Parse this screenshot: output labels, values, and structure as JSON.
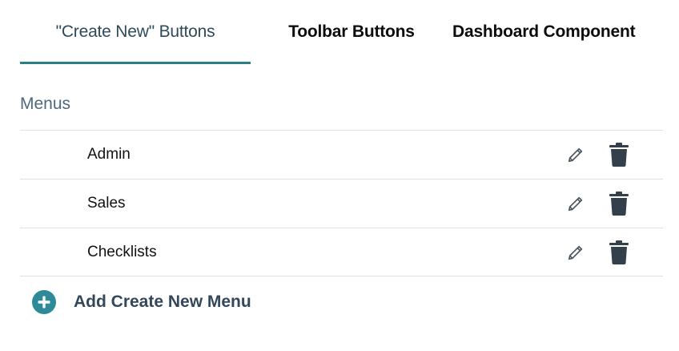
{
  "tabs": [
    {
      "label": "\"Create New\" Buttons",
      "active": true
    },
    {
      "label": "Toolbar Buttons",
      "active": false
    },
    {
      "label": "Dashboard Component",
      "active": false
    }
  ],
  "section": {
    "title": "Menus"
  },
  "menus": [
    {
      "label": "Admin"
    },
    {
      "label": "Sales"
    },
    {
      "label": "Checklists"
    }
  ],
  "add_menu": {
    "label": "Add Create New Menu"
  },
  "colors": {
    "accent": "#2b7f86",
    "add_icon": "#2e8a99",
    "icon_dark": "#33404b"
  },
  "icons": {
    "edit": "pencil-icon",
    "delete": "trash-icon",
    "add": "plus-circle-icon"
  }
}
